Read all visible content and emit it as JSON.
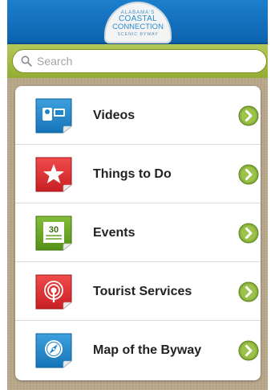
{
  "header": {
    "logo_line1": "ALABAMA'S",
    "logo_line2": "COASTAL",
    "logo_line3": "CONNECTION",
    "logo_line4": "SCENIC BYWAY",
    "background": "#0b62ad"
  },
  "search": {
    "placeholder": "Search"
  },
  "menu": {
    "items": [
      {
        "label": "Videos",
        "icon": "video-camera-icon",
        "color": "#1f87c8"
      },
      {
        "label": "Things to Do",
        "icon": "star-icon",
        "color": "#df2f2f"
      },
      {
        "label": "Events",
        "icon": "calendar-icon",
        "color": "#6aa427",
        "calendar_day": "30"
      },
      {
        "label": "Tourist Services",
        "icon": "info-signal-icon",
        "color": "#df2f2f"
      },
      {
        "label": "Map of the Byway",
        "icon": "compass-icon",
        "color": "#1f87c8"
      }
    ],
    "chevron_color": "#7aa33a"
  }
}
